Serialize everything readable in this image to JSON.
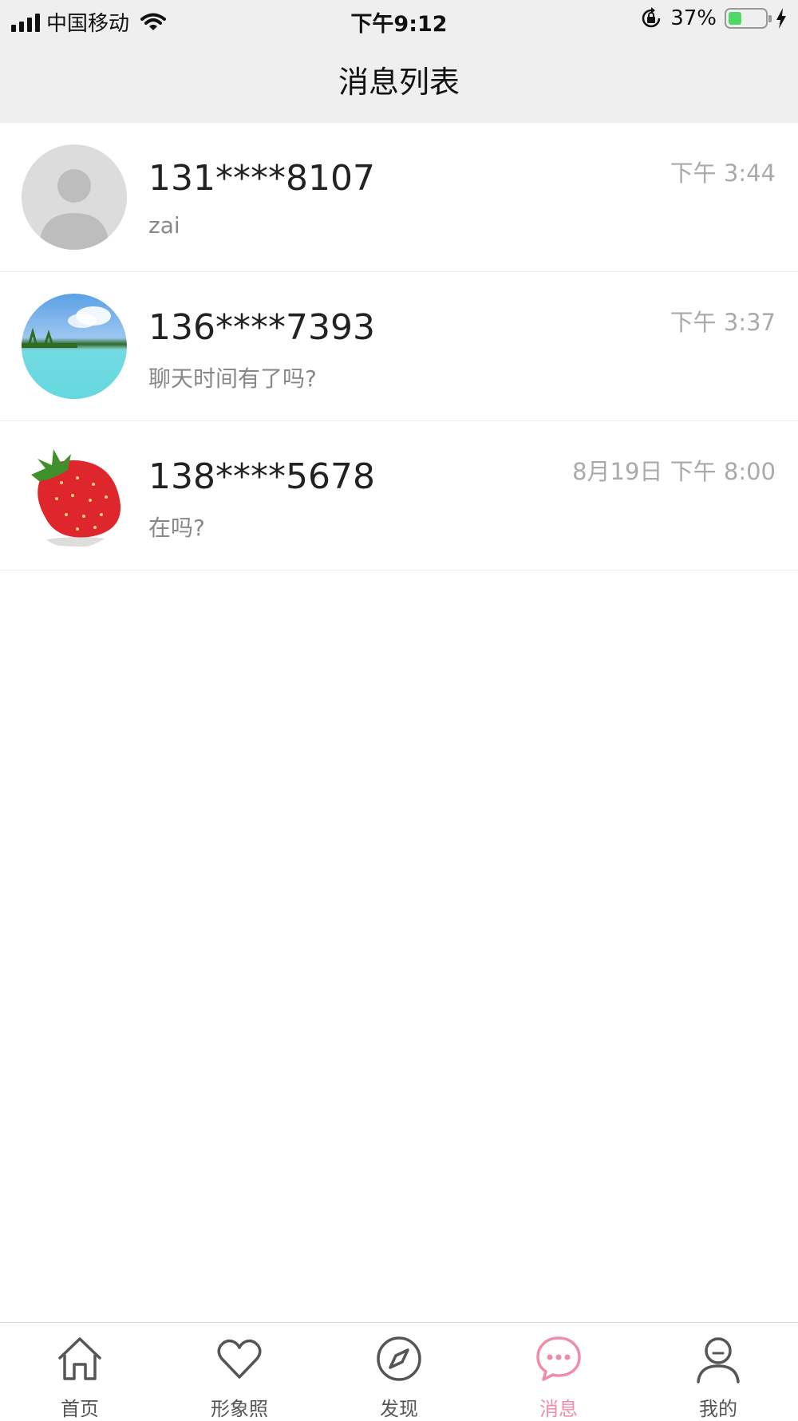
{
  "status_bar": {
    "carrier": "中国移动",
    "time": "下午9:12",
    "battery_percent": "37%",
    "battery_level": 0.37,
    "battery_color": "#4cd964"
  },
  "header": {
    "title": "消息列表"
  },
  "messages": [
    {
      "name": "131****8107",
      "preview": "zai",
      "time": "下午 3:44",
      "avatar": "default-avatar"
    },
    {
      "name": "136****7393",
      "preview": "聊天时间有了吗?",
      "time": "下午 3:37",
      "avatar": "beach-avatar"
    },
    {
      "name": "138****5678",
      "preview": "在吗?",
      "time": "8月19日 下午 8:00",
      "avatar": "strawberry-avatar"
    }
  ],
  "tabbar": {
    "active_color": "#f08ca8",
    "tabs": [
      {
        "label": "首页",
        "icon": "home-icon"
      },
      {
        "label": "形象照",
        "icon": "heart-icon"
      },
      {
        "label": "发现",
        "icon": "compass-icon"
      },
      {
        "label": "消息",
        "icon": "chat-bubble-icon",
        "active": true
      },
      {
        "label": "我的",
        "icon": "person-icon"
      }
    ]
  }
}
